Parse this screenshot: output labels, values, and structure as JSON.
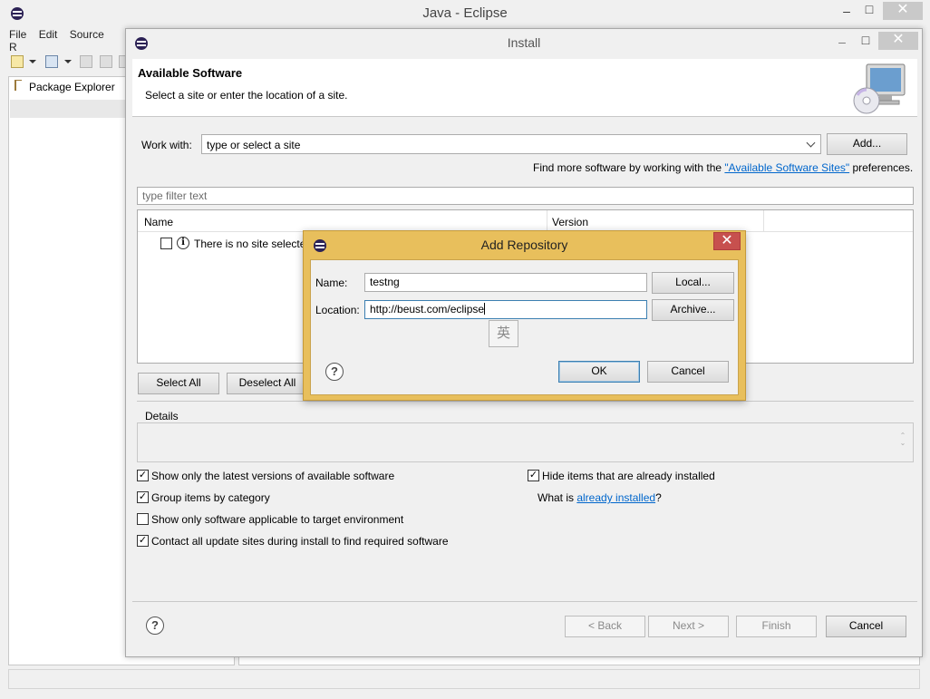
{
  "eclipse": {
    "title": "Java - Eclipse",
    "menu": [
      "File",
      "Edit",
      "Source",
      "R"
    ],
    "package_explorer_tab": "Package Explorer",
    "window_controls": {
      "minimize": "–",
      "maximize": "□",
      "close": "✕"
    }
  },
  "install": {
    "title": "Install",
    "header": {
      "title": "Available Software",
      "description": "Select a site or enter the location of a site."
    },
    "work_with": {
      "label": "Work with:",
      "value": "type or select a site",
      "add_button": "Add..."
    },
    "find_more": {
      "prefix": "Find more software by working with the ",
      "link": "\"Available Software Sites\"",
      "suffix": " preferences."
    },
    "filter": {
      "placeholder": "type filter text"
    },
    "tree": {
      "columns": [
        "Name",
        "Version"
      ],
      "rows": [
        {
          "label": "There is no site selected."
        }
      ]
    },
    "select_all": "Select All",
    "deselect_all": "Deselect All",
    "details_label": "Details",
    "options": {
      "latest_versions": {
        "label": "Show only the latest versions of available software",
        "checked": true
      },
      "group_by_category": {
        "label": "Group items by category",
        "checked": true
      },
      "applicable_only": {
        "label": "Show only software applicable to target environment",
        "checked": false
      },
      "contact_all_sites": {
        "label": "Contact all update sites during install to find required software",
        "checked": true
      },
      "hide_installed": {
        "label": "Hide items that are already installed",
        "checked": true
      }
    },
    "what_is": {
      "prefix": "What is ",
      "link": "already installed",
      "suffix": "?"
    },
    "footer": {
      "back": "< Back",
      "next": "Next >",
      "finish": "Finish",
      "cancel": "Cancel"
    }
  },
  "add_repository": {
    "title": "Add Repository",
    "name": {
      "label": "Name:",
      "value": "testng"
    },
    "location": {
      "label": "Location:",
      "value": "http://beust.com/eclipse"
    },
    "local_button": "Local...",
    "archive_button": "Archive...",
    "ok_button": "OK",
    "cancel_button": "Cancel",
    "ime_indicator": "英"
  },
  "colors": {
    "dialog_accent": "#e8bf5c",
    "close_button": "#c7504e",
    "link": "#0066cc"
  }
}
